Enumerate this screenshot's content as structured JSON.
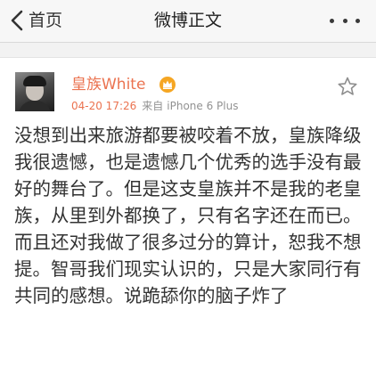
{
  "nav": {
    "back_label": "首页",
    "title": "微博正文",
    "back_icon": "chevron-left-icon",
    "more_icon": "more-dots-icon"
  },
  "post": {
    "username": "皇族White",
    "badge_icon": "vip-crown-badge-icon",
    "time": "04-20 17:26",
    "source_prefix": "来自",
    "source": "iPhone 6 Plus",
    "favorite_icon": "star-outline-icon",
    "text": "没想到出来旅游都要被咬着不放，皇族降级我很遗憾，也是遗憾几个优秀的选手没有最好的舞台了。但是这支皇族并不是我的老皇族，从里到外都换了，只有名字还在而已。而且还对我做了很多过分的算计，恕我不想提。智哥我们现实认识的，只是大家同行有共同的感想。说跪舔你的脑子炸了"
  },
  "colors": {
    "accent": "#eb7350",
    "background": "#f2f2f2",
    "card": "#ffffff",
    "text": "#333333",
    "muted": "#929292",
    "badge": "#f5a623"
  }
}
